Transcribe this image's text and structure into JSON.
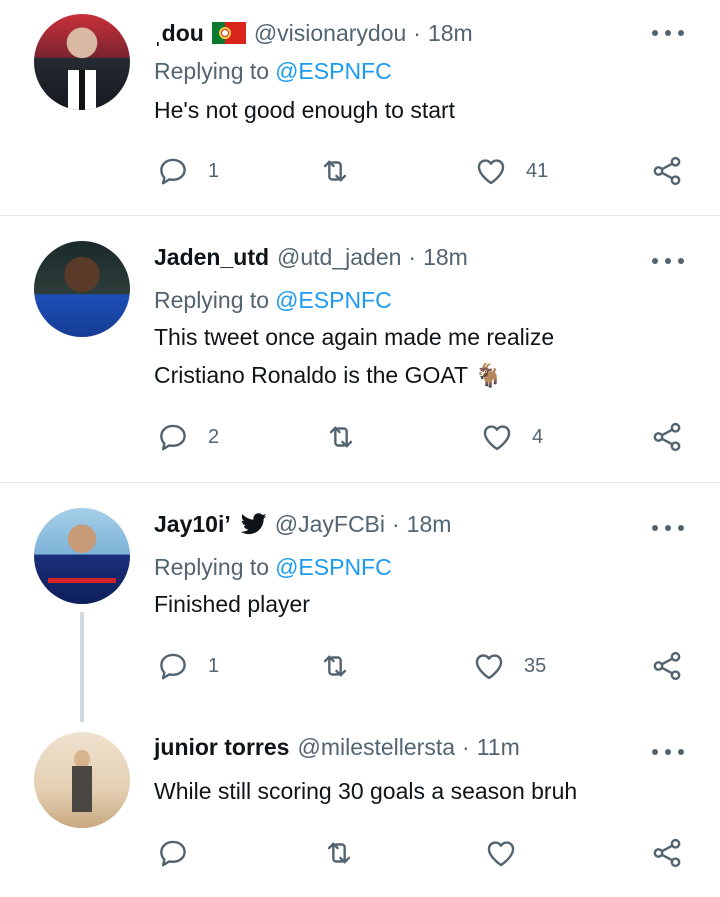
{
  "tweets": [
    {
      "name": "ˌdou",
      "handle": "@visionarydou",
      "sep": "·",
      "time": "18m",
      "reply_prefix": "Replying to",
      "reply_mention": "@ESPNFC",
      "lines": [
        "He's not good enough to start"
      ],
      "replies": "1",
      "retweets": "",
      "likes": "41",
      "badge": "portugal-flag"
    },
    {
      "name": "Jaden_utd",
      "handle": "@utd_jaden",
      "sep": "·",
      "time": "18m",
      "reply_prefix": "Replying to",
      "reply_mention": "@ESPNFC",
      "lines": [
        "This tweet once again made me realize",
        "Cristiano Ronaldo is the GOAT 🐐"
      ],
      "replies": "2",
      "retweets": "",
      "likes": "4"
    },
    {
      "name": "Jay10i’",
      "handle": "@JayFCBi",
      "sep": "·",
      "time": "18m",
      "reply_prefix": "Replying to",
      "reply_mention": "@ESPNFC",
      "lines": [
        "Finished player"
      ],
      "replies": "1",
      "retweets": "",
      "likes": "35",
      "badge": "bird-icon"
    },
    {
      "name": "junior torres",
      "handle": "@milestellersta",
      "sep": "·",
      "time": "11m",
      "lines": [
        "While still scoring 30 goals a season bruh"
      ],
      "replies": "",
      "retweets": "",
      "likes": ""
    }
  ],
  "colors": {
    "text": "#0f1419",
    "muted": "#536471",
    "accent": "#1d9bf0",
    "divider": "#e6e9eb"
  }
}
